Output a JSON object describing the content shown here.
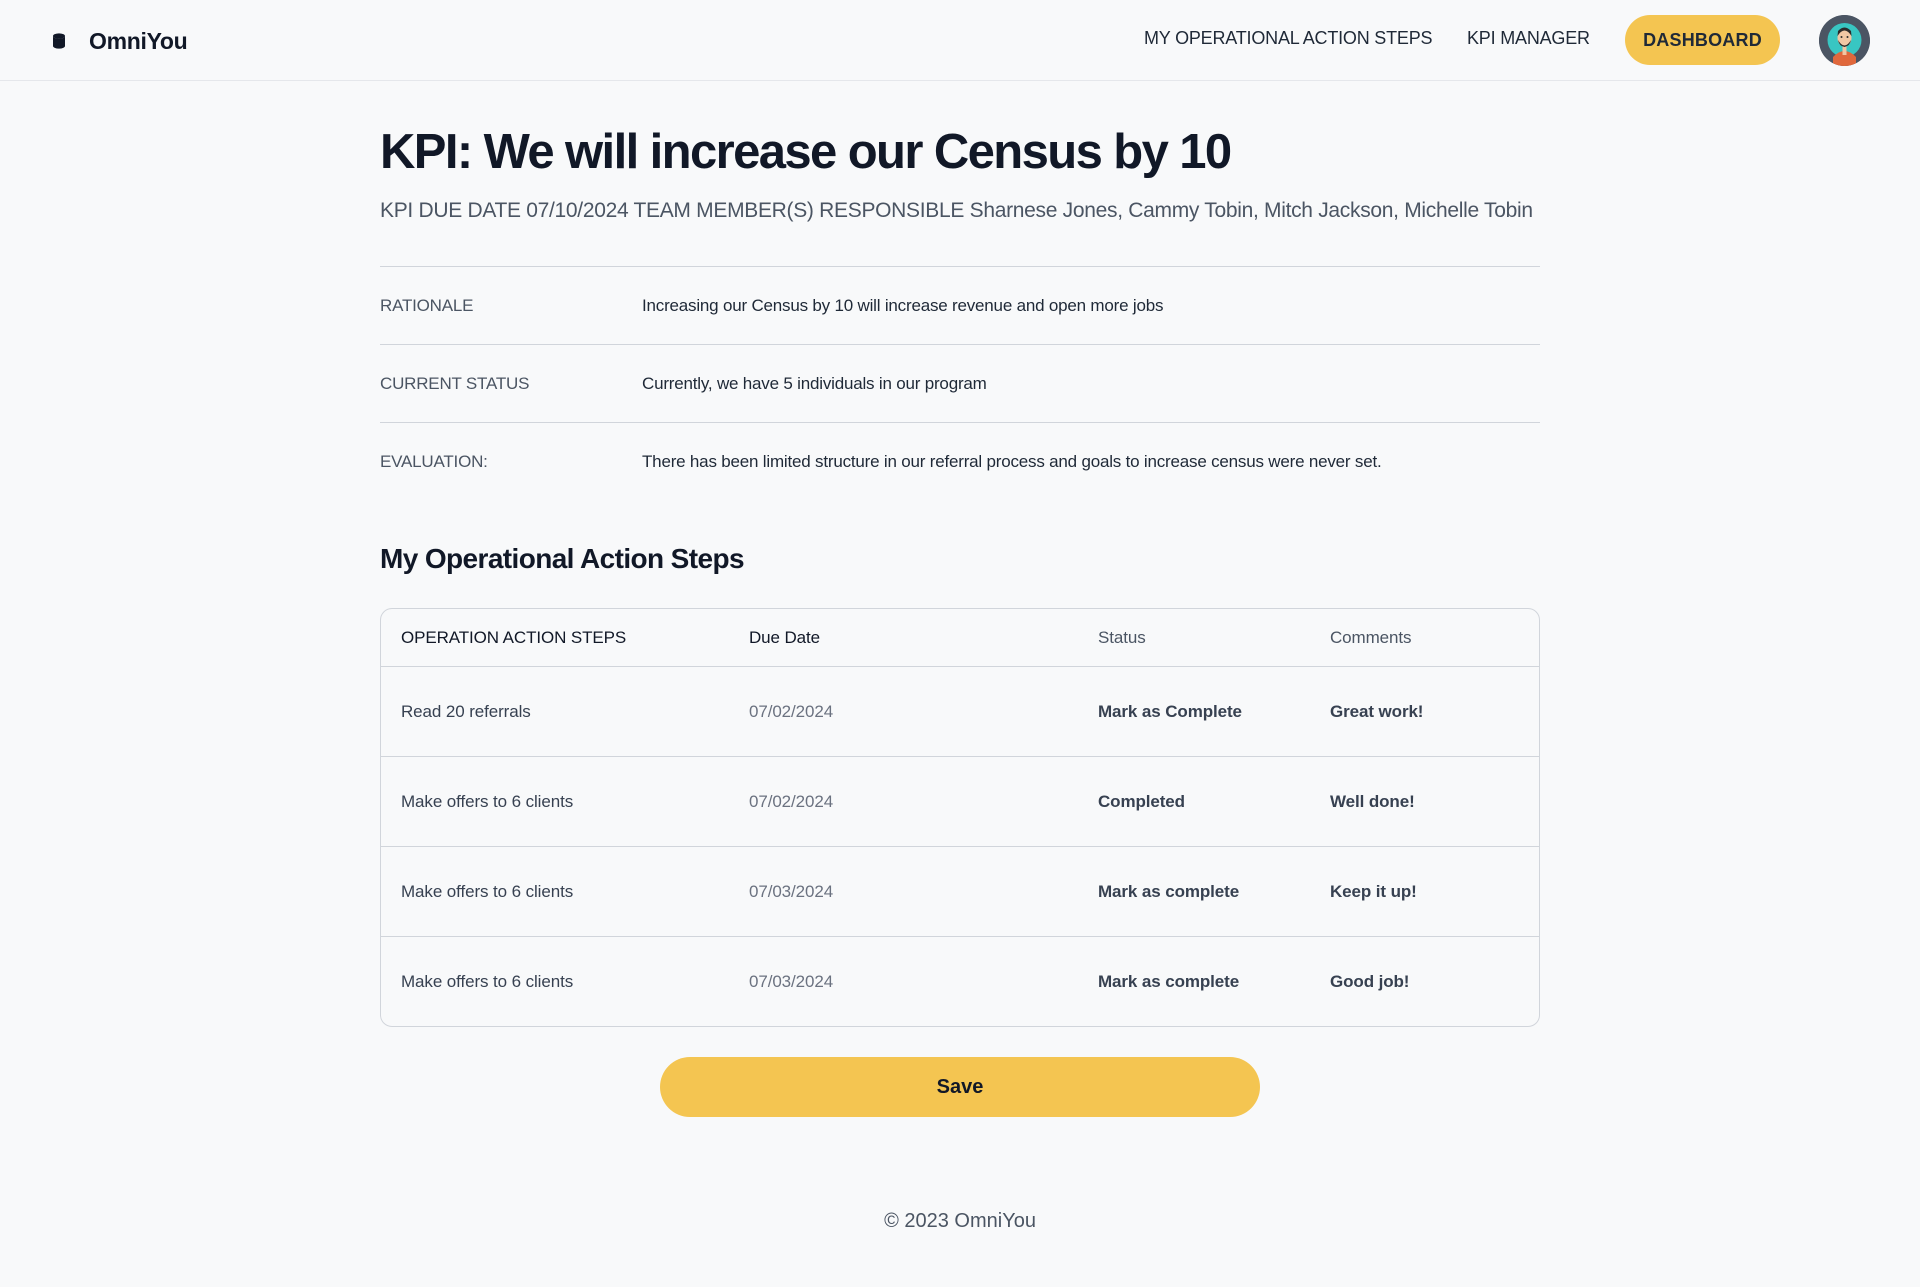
{
  "header": {
    "logo_text": "OmniYou",
    "logo_icon": "database-icon",
    "nav": {
      "operational_action_steps": "MY OPERATIONAL ACTION STEPS",
      "kpi_manager": "KPI MANAGER",
      "dashboard": "DASHBOARD"
    },
    "avatar_icon": "user-avatar-icon"
  },
  "kpi": {
    "title": "KPI: We will increase our Census by 10",
    "subline": "KPI DUE DATE 07/10/2024 TEAM MEMBER(S) RESPONSIBLE Sharnese Jones, Cammy Tobin, Mitch Jackson, Michelle Tobin",
    "details": [
      {
        "label": "RATIONALE",
        "value": "Increasing our Census by 10 will increase revenue and open more jobs"
      },
      {
        "label": "CURRENT STATUS",
        "value": "Currently, we have 5 individuals in our program"
      },
      {
        "label": "EVALUATION:",
        "value": "There has been limited structure in our referral process and goals to increase census were never set."
      }
    ]
  },
  "steps": {
    "section_title": "My Operational Action Steps",
    "columns": {
      "step": "OPERATION ACTION STEPS",
      "due_date": "Due Date",
      "status": "Status",
      "comments": "Comments"
    },
    "rows": [
      {
        "step": "Read 20 referrals",
        "due_date": "07/02/2024",
        "status": "Mark as Complete",
        "comments": "Great work!"
      },
      {
        "step": "Make offers to 6 clients",
        "due_date": "07/02/2024",
        "status": "Completed",
        "comments": "Well done!"
      },
      {
        "step": "Make offers to 6 clients",
        "due_date": "07/03/2024",
        "status": "Mark as complete",
        "comments": "Keep it up!"
      },
      {
        "step": "Make offers to 6 clients",
        "due_date": "07/03/2024",
        "status": "Mark as complete",
        "comments": "Good job!"
      }
    ]
  },
  "save_label": "Save",
  "footer": "© 2023 OmniYou",
  "colors": {
    "accent": "#f4c551",
    "background": "#f8f9fa",
    "text": "#111827"
  }
}
